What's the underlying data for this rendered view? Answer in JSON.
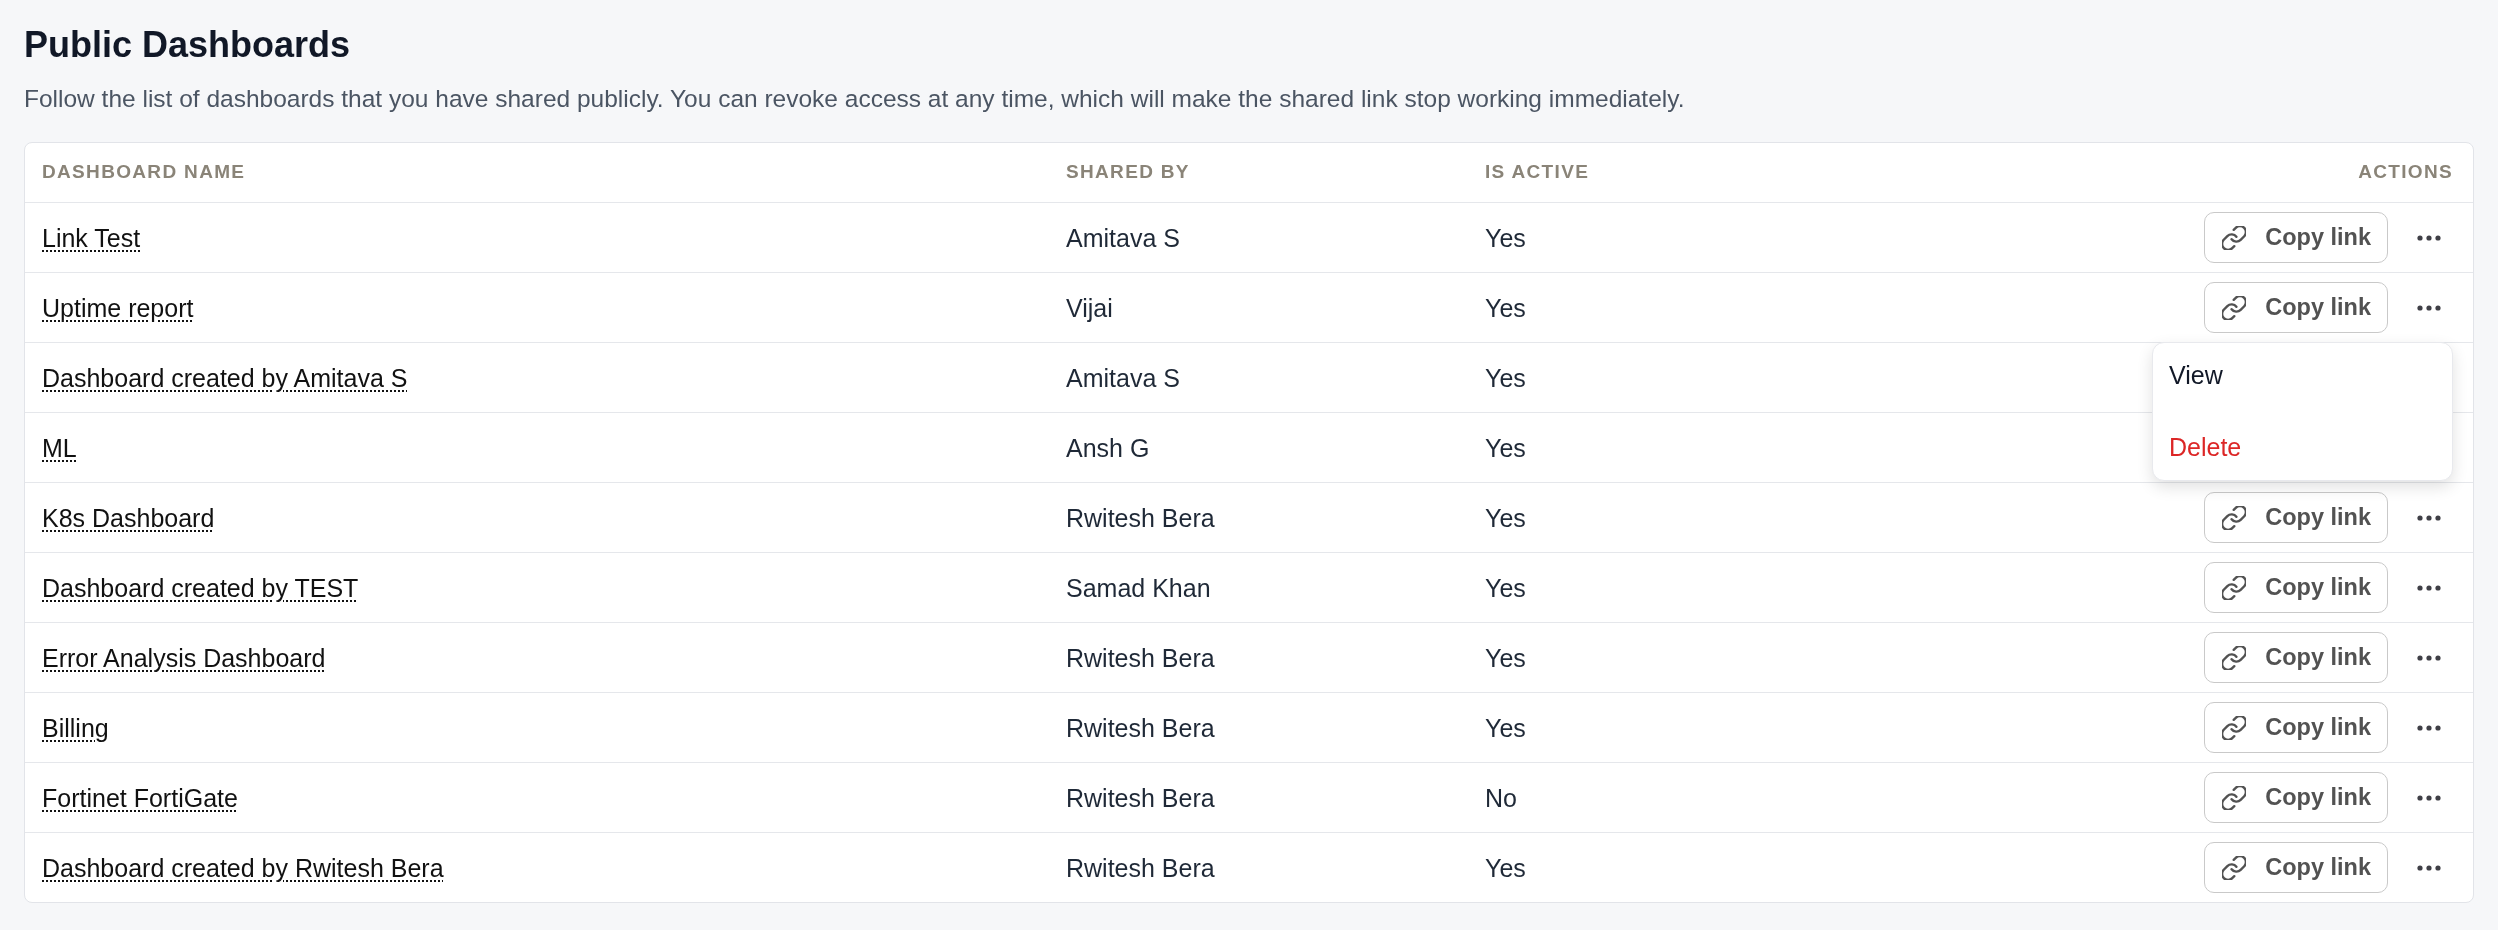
{
  "page": {
    "title": "Public Dashboards",
    "description": "Follow the list of dashboards that you have shared publicly. You can revoke access at any time, which will make the shared link stop working immediately."
  },
  "table": {
    "columns": [
      "DASHBOARD NAME",
      "SHARED BY",
      "IS ACTIVE",
      "ACTIONS"
    ],
    "rows": [
      {
        "name": "Link Test",
        "shared_by": "Amitava S",
        "is_active": "Yes",
        "copy_link": "Copy link"
      },
      {
        "name": "Uptime report",
        "shared_by": "Vijai",
        "is_active": "Yes",
        "copy_link": "Copy link",
        "menu": {
          "items": [
            {
              "label": "View",
              "kind": "default"
            },
            {
              "label": "Delete",
              "kind": "danger"
            }
          ]
        }
      },
      {
        "name": "Dashboard created by Amitava S",
        "shared_by": "Amitava S",
        "is_active": "Yes"
      },
      {
        "name": "ML",
        "shared_by": "Ansh G",
        "is_active": "Yes"
      },
      {
        "name": "K8s Dashboard",
        "shared_by": "Rwitesh Bera",
        "is_active": "Yes",
        "copy_link": "Copy link"
      },
      {
        "name": "Dashboard created by TEST",
        "shared_by": "Samad Khan",
        "is_active": "Yes",
        "copy_link": "Copy link"
      },
      {
        "name": "Error Analysis Dashboard",
        "shared_by": "Rwitesh Bera",
        "is_active": "Yes",
        "copy_link": "Copy link"
      },
      {
        "name": "Billing",
        "shared_by": "Rwitesh Bera",
        "is_active": "Yes",
        "copy_link": "Copy link"
      },
      {
        "name": "Fortinet FortiGate",
        "shared_by": "Rwitesh Bera",
        "is_active": "No",
        "copy_link": "Copy link"
      },
      {
        "name": "Dashboard created by Rwitesh Bera",
        "shared_by": "Rwitesh Bera",
        "is_active": "Yes",
        "copy_link": "Copy link"
      }
    ]
  }
}
